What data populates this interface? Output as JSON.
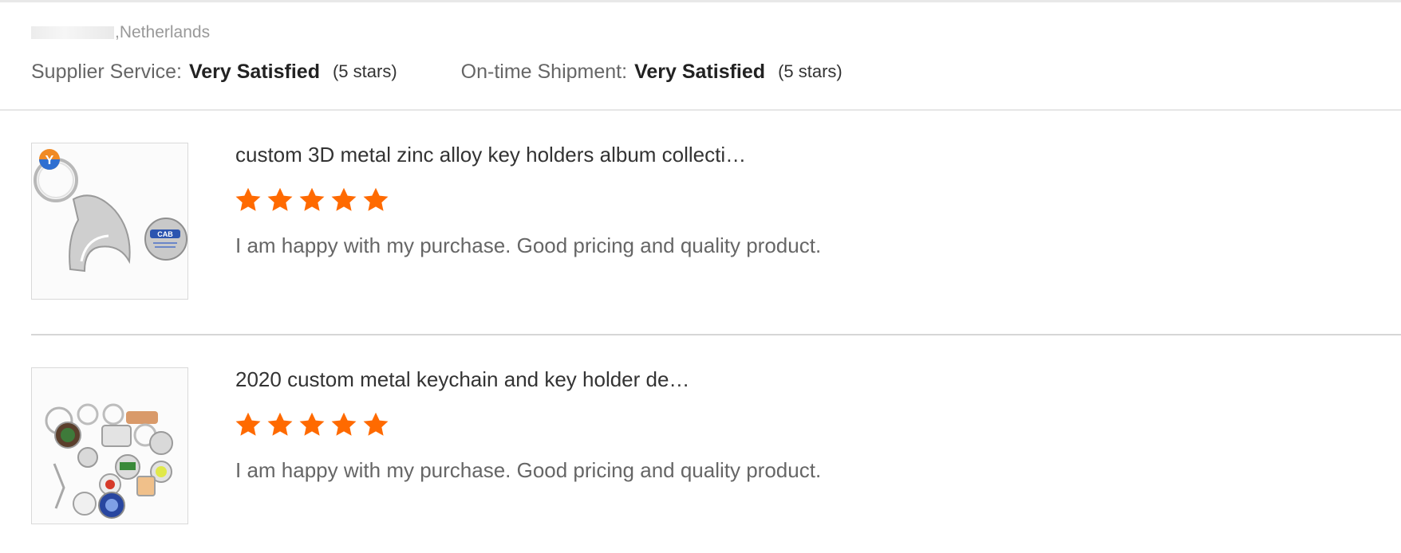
{
  "reviewer": {
    "location": ",Netherlands"
  },
  "summary": {
    "supplier_service_label": "Supplier Service:",
    "supplier_service_value": "Very Satisfied",
    "supplier_service_stars": "(5 stars)",
    "shipment_label": "On-time Shipment:",
    "shipment_value": "Very Satisfied",
    "shipment_stars": "(5 stars)"
  },
  "reviews": [
    {
      "product_title": "custom 3D metal zinc alloy key holders album collecti…",
      "rating": 5,
      "comment": "I am happy with my purchase. Good pricing and quality product.",
      "thumb_badge": "Y",
      "coin_text": "CAB"
    },
    {
      "product_title": "2020 custom metal keychain and key holder de…",
      "rating": 5,
      "comment": "I am happy with my purchase. Good pricing and quality product."
    }
  ],
  "colors": {
    "star": "#ff6a00",
    "text": "#333333",
    "muted": "#666666",
    "border": "#d9d9d9"
  }
}
